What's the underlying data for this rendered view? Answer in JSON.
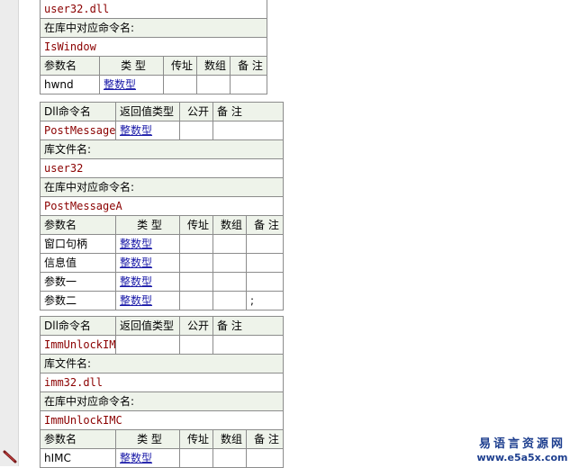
{
  "labels": {
    "dll_cmd": "Dll命令名",
    "ret_type": "返回值类型",
    "public": "公开",
    "remark": "备 注",
    "lib_file": "库文件名:",
    "lib_cmd": "在库中对应命令名:",
    "param_name": "参数名",
    "type": "类 型",
    "by_ref": "传址",
    "array": "数组"
  },
  "block0": {
    "lib": "user32.dll",
    "lib_cmd": "IsWindow",
    "params": [
      {
        "name": "hwnd",
        "type": "整数型",
        "note": ""
      }
    ]
  },
  "block1": {
    "name": "PostMessageA",
    "ret": "整数型",
    "lib": "user32",
    "lib_cmd": "PostMessageA",
    "params": [
      {
        "name": "窗口句柄",
        "type": "整数型",
        "note": ""
      },
      {
        "name": "信息值",
        "type": "整数型",
        "note": ""
      },
      {
        "name": "参数一",
        "type": "整数型",
        "note": ""
      },
      {
        "name": "参数二",
        "type": "整数型",
        "note": ";"
      }
    ]
  },
  "block2": {
    "name": "ImmUnlockIMC",
    "ret": "",
    "lib": "imm32.dll",
    "lib_cmd": "ImmUnlockIMC",
    "params": [
      {
        "name": "hIMC",
        "type": "整数型",
        "note": ""
      }
    ]
  },
  "watermark": {
    "cn": "易语言资源网",
    "en": "www.e5a5x.com"
  },
  "icons": {
    "gutter": "pencil-icon"
  },
  "colors": {
    "header_bg": "#eef3ea",
    "value_text": "#8b0000",
    "link_text": "#1a1aa8",
    "watermark": "#1e3f8f"
  }
}
